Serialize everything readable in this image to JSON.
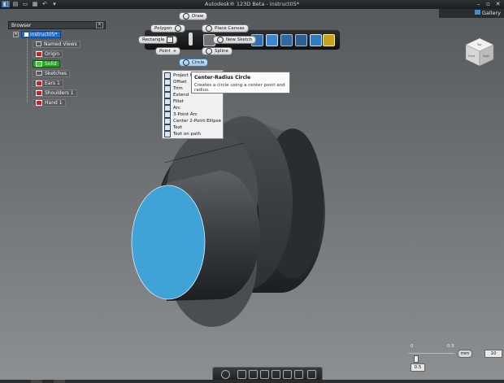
{
  "window": {
    "title": "Autodesk® 123D Beta - instruct05*",
    "gallery_label": "Gallery",
    "minimize": "–",
    "restore": "▫",
    "close": "✕"
  },
  "browser": {
    "title": "Browser",
    "items": [
      {
        "label": "instruct05*"
      },
      {
        "label": "Named Views"
      },
      {
        "label": "Origin"
      },
      {
        "label": "Solid"
      },
      {
        "label": "Sketches"
      },
      {
        "label": "Ears 1"
      },
      {
        "label": "Shoulders 1"
      },
      {
        "label": "Hand 1"
      }
    ]
  },
  "sketch_tools": {
    "draw": "Draw",
    "polygon": "Polygon",
    "rectangle": "Rectangle",
    "point": "Point",
    "circle": "Circle",
    "place_canvas": "Place Canvas",
    "new_sketch": "New Sketch",
    "spline": "Spline"
  },
  "menu": {
    "items": [
      "Project Geometry",
      "Offset",
      "Trim",
      "Extend",
      "Fillet",
      "Arc",
      "3-Point Arc",
      "Center 2-Point Ellipse",
      "Text",
      "Text on path"
    ]
  },
  "tooltip": {
    "title": "Center-Radius Circle",
    "description": "Creates a circle using a center point and radius."
  },
  "viewcube": {
    "face_top": "Top",
    "face_left": "Front",
    "face_right": "Right"
  },
  "zoom": {
    "min_label": "0",
    "max_label": "0.5",
    "current": "0.5",
    "unit": "mm",
    "value": "10"
  },
  "colors": {
    "cylinder_face": "#3fa3d8",
    "body": "#3b3e41"
  }
}
